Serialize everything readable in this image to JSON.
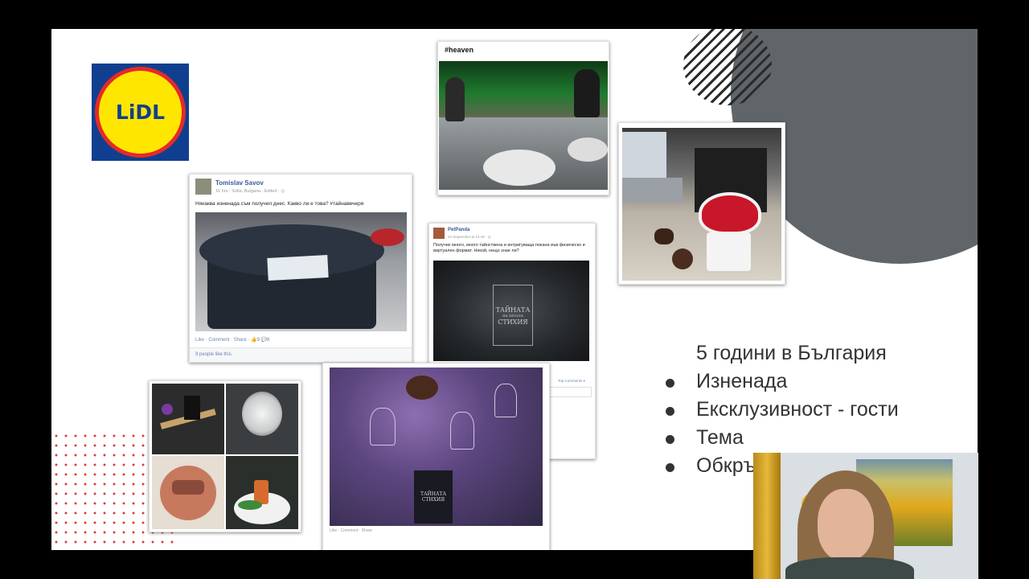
{
  "slide": {
    "logo_text": "LiDL",
    "bullets": [
      {
        "text": "5 години в България",
        "bullet": false
      },
      {
        "text": "Изненада",
        "bullet": true
      },
      {
        "text": "Ексклузивност - гости",
        "bullet": true
      },
      {
        "text": "Тема",
        "bullet": true
      },
      {
        "text": "Обкръжаващ",
        "bullet": true
      }
    ]
  },
  "post_heaven": {
    "caption": "#heaven"
  },
  "post_tomislav": {
    "name": "Tomislav Savov",
    "meta": "16 hrs · Sofia, Bulgaria · Edited · ◎",
    "text": "Някаква изненада съм получил днес. Какво ли е това? #тайнавечеря",
    "actions": "Like · Comment · Share · 👍9 💬8",
    "likes": "9 people like this."
  },
  "post_petpanda": {
    "name": "PetPanda",
    "meta": "22 September at 14:48 · ◎",
    "text": "Получих много, много тайнствена и интригуваща покана във физическо и виртуален формат. Някой, нещо знае ли?",
    "emblem_line1": "ТАЙНАТА",
    "emblem_line2": "на петата",
    "emblem_line3": "СТИХИЯ",
    "top_comments": "Top Comments ▾"
  },
  "post_table": {
    "actions": "Like · Comment · Share",
    "emblem": "ТАЙНАТА СТИХИЯ"
  },
  "colors": {
    "slide_gray": "#5f6568",
    "lidl_blue": "#103f8f",
    "lidl_yellow": "#ffe600",
    "lidl_red": "#e52a2a",
    "fb_blue": "#3b5998"
  }
}
